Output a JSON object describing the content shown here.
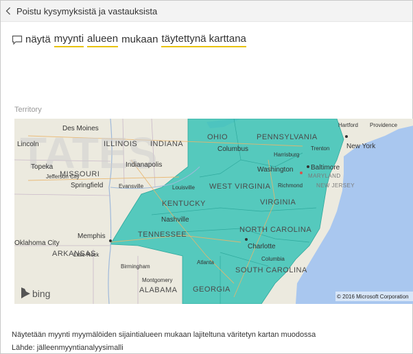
{
  "header": {
    "back_label": "Poistu kysymyksistä ja vastauksista"
  },
  "question": {
    "words": [
      {
        "text": "näytä",
        "underlined": false
      },
      {
        "text": "myynti",
        "underlined": true
      },
      {
        "text": "alueen",
        "underlined": true
      },
      {
        "text": "mukaan",
        "underlined": false
      },
      {
        "text": "täytettynä karttana",
        "underlined": true
      }
    ],
    "underline_color": "#e8c200"
  },
  "visual": {
    "title": "Territory",
    "fill_color": "#40c4b8",
    "water_color": "#a9c7ef",
    "land_color": "#eceadf",
    "attribution": "© 2016 Microsoft Corporation",
    "logo_text": "bing",
    "watermark": "TATES",
    "states": [
      "ILLINOIS",
      "INDIANA",
      "OHIO",
      "PENNSYLVANIA",
      "MISSOURI",
      "WEST VIRGINIA",
      "KENTUCKY",
      "VIRGINIA",
      "TENNESSEE",
      "NORTH CAROLINA",
      "ARKANSAS",
      "SOUTH CAROLINA",
      "ALABAMA",
      "GEORGIA",
      "MARYLAND",
      "NEW JERSEY"
    ],
    "cities": [
      "Des Moines",
      "Lincoln",
      "Topeka",
      "Jefferson City",
      "Springfield",
      "Indianapolis",
      "Evansville",
      "Columbus",
      "Harrisburg",
      "Trenton",
      "Hartford",
      "Providence",
      "New York",
      "Washington",
      "Baltimore",
      "Richmond",
      "Louisville",
      "Nashville",
      "Memphis",
      "Charlotte",
      "Atlanta",
      "Birmingham",
      "Montgomery",
      "Columbia",
      "Little Rock",
      "Oklahoma City"
    ]
  },
  "footer": {
    "description": "Näytetään myynti myymälöiden sijaintialueen mukaan lajiteltuna väritetyn kartan muodossa",
    "source": "Lähde: jälleenmyyntianalyysimalli"
  }
}
